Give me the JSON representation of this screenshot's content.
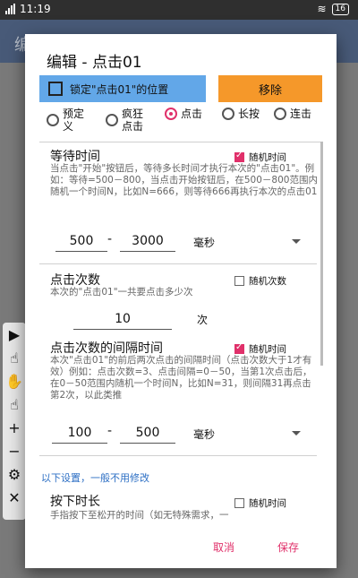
{
  "status_bar": {
    "time": "11:19",
    "battery": "16"
  },
  "app_bar": {
    "title_partial": "编"
  },
  "side_toolbar": [
    "▶",
    "☝",
    "✋",
    "☝",
    "+",
    "−",
    "⚙",
    "✕"
  ],
  "dialog": {
    "title": "编辑 - 点击01",
    "lock_button": "锁定\"点击01\"的位置",
    "remove_button": "移除",
    "radio_options": [
      {
        "label": "预定义",
        "checked": false
      },
      {
        "label": "疯狂点击",
        "checked": false
      },
      {
        "label": "点击",
        "checked": true
      },
      {
        "label": "长按",
        "checked": false
      },
      {
        "label": "连击",
        "checked": false
      }
    ],
    "wait_time": {
      "title": "等待时间",
      "random_label": "随机时间",
      "random_checked": true,
      "description": "当点击\"开始\"按钮后，等待多长时间才执行本次的\"点击01\"。例如：等待=500－800，当点击开始按钮后，在500－800范围内随机一个时间N，比如N=666，则等待666再执行本次的点击01",
      "min": "500",
      "max": "3000",
      "unit": "毫秒"
    },
    "click_count": {
      "title": "点击次数",
      "random_label": "随机次数",
      "random_checked": false,
      "description": "本次的\"点击01\"一共要点击多少次",
      "value": "10",
      "unit": "次"
    },
    "click_interval": {
      "title": "点击次数的间隔时间",
      "random_label": "随机时间",
      "random_checked": true,
      "description": "本次\"点击01\"的前后两次点击的间隔时间（点击次数大于1才有效）例如：点击次数=3、点击间隔=0－50，当第1次点击后，在0－50范围内随机一个时间N，比如N=31，则间隔31再点击第2次，以此类推",
      "min": "100",
      "max": "500",
      "unit": "毫秒"
    },
    "advanced_note": "以下设置，一般不用修改",
    "press_duration": {
      "title": "按下时长",
      "random_label": "随机时间",
      "random_checked": false,
      "description": "手指按下至松开的时间（如无特殊需求，一"
    },
    "cancel": "取消",
    "save": "保存"
  }
}
